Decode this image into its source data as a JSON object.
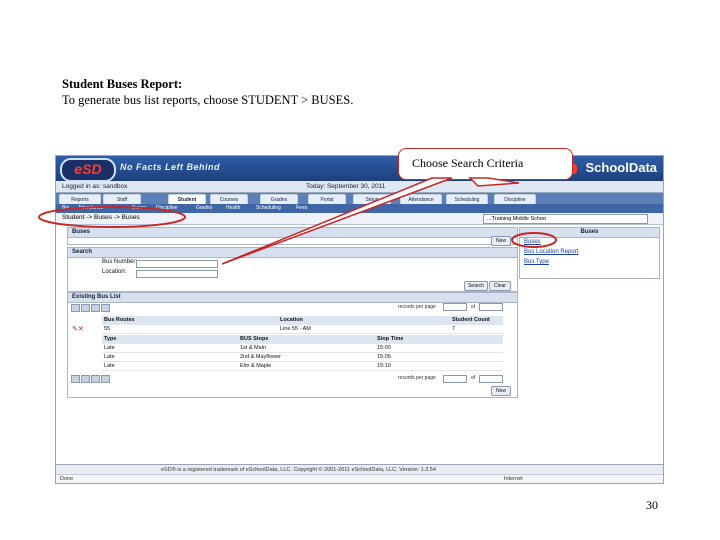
{
  "slide": {
    "title": "Student Buses Report:",
    "description": "To generate bus list reports, choose STUDENT > BUSES.",
    "page_number": "30",
    "callout": "Choose Search Criteria"
  },
  "app": {
    "logo": "eSD",
    "tagline": "No Facts Left Behind",
    "brand": "SchoolData",
    "logged_in": "Logged in as: sandbox",
    "date": "Today: September 30, 2011",
    "tabs": [
      "Reports",
      "Staff",
      "Student",
      "Courses",
      "Grades",
      "Portal",
      "Setup",
      "Attendance",
      "Scheduling",
      "Discipline"
    ],
    "active_tab": "Student",
    "subnav": [
      "Bio",
      "Attendance",
      "Buses",
      "Discipline",
      "Grades",
      "Health",
      "Scheduling",
      "Fees"
    ],
    "breadcrumb": "Student -> Buses -> Buses",
    "school_select": "...Training Middle Schoo",
    "buses_panel": {
      "title": "Buses",
      "new_button": "New",
      "search_title": "Search",
      "bus_number_label": "Bus Number:",
      "location_label": "Location:",
      "search_button": "Search",
      "clear_button": "Clear"
    },
    "bus_list": {
      "title": "Existing Bus List",
      "records_per_page": "records per page",
      "page_of": "of",
      "columns": [
        "Bus Routes",
        "Location",
        "Student Count"
      ],
      "rows": [
        {
          "route": "55",
          "location": "Line 55 - AM",
          "count": "7"
        }
      ],
      "stop_columns": [
        "Type",
        "BUS Stops",
        "Stop Time"
      ],
      "stop_rows": [
        {
          "type": "Late",
          "stop": "1st & Main",
          "time": "15:00"
        },
        {
          "type": "Late",
          "stop": "2nd & Mayflower",
          "time": "15:05"
        },
        {
          "type": "Late",
          "stop": "Elm & Maple",
          "time": "15:10"
        }
      ],
      "new_button": "New"
    },
    "right_panel": {
      "title": "Buses",
      "links": [
        "Buses",
        "Bus Location Report",
        "Bus Type"
      ]
    },
    "status_bar": "eSD® is a registered trademark of eSchoolData, LLC. Copyright © 2001-2011 eSchoolData, LLC. Version: 1.3.54",
    "browser_status_left": "Done",
    "browser_status_right": "Internet"
  }
}
